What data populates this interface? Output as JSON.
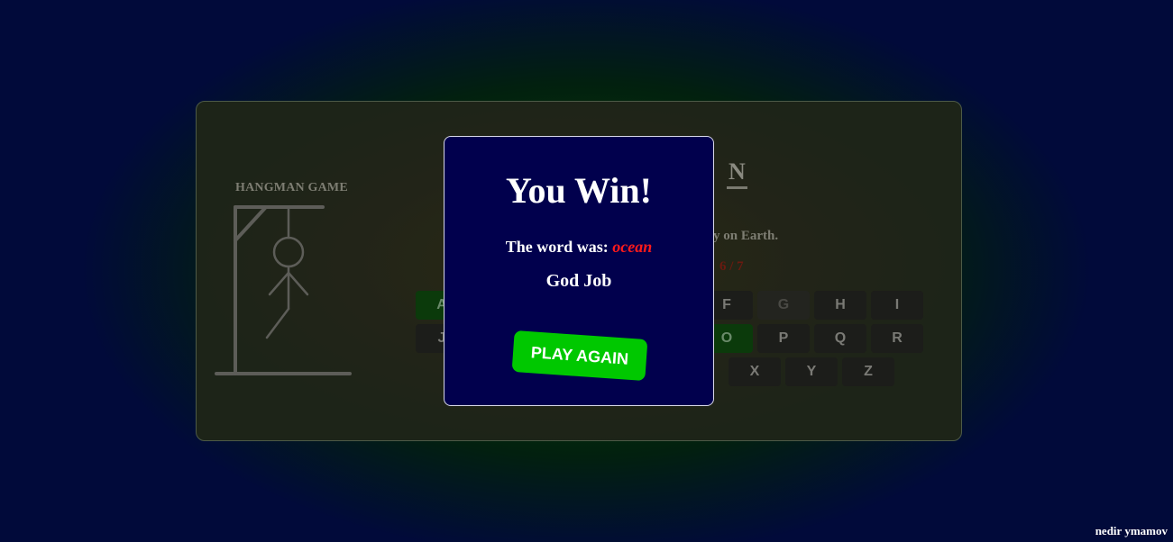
{
  "game": {
    "title": "HANGMAN GAME",
    "revealed_letter": "N",
    "hint_fragment": "y on Earth.",
    "wrong_fragment": "6 / 7"
  },
  "keyboard": {
    "row1": [
      "A",
      "F",
      "G",
      "H",
      "I"
    ],
    "row2": [
      "J",
      "O",
      "P",
      "Q",
      "R"
    ],
    "row3": [
      "X",
      "Y",
      "Z"
    ]
  },
  "modal": {
    "title": "You Win!",
    "word_label": "The word was: ",
    "word": "ocean",
    "message": "God Job",
    "button_label": "PLAY AGAIN"
  },
  "footer": {
    "author": "nedir ymamov"
  },
  "colors": {
    "modal_bg": "#01004d",
    "play_button": "#00c800",
    "answer_word": "#ff1a1a"
  }
}
